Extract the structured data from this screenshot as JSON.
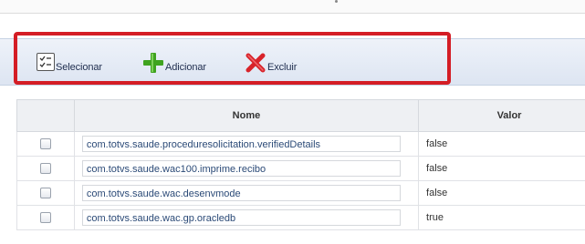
{
  "toolbar": {
    "select_label": "Selecionar",
    "add_label": "Adicionar",
    "delete_label": "Excluir"
  },
  "table": {
    "headers": {
      "nome": "Nome",
      "valor": "Valor"
    },
    "rows": [
      {
        "nome": "com.totvs.saude.proceduresolicitation.verifiedDetails",
        "valor": "false"
      },
      {
        "nome": "com.totvs.saude.wac100.imprime.recibo",
        "valor": "false"
      },
      {
        "nome": "com.totvs.saude.wac.desenvmode",
        "valor": "false"
      },
      {
        "nome": "com.totvs.saude.wac.gp.oracledb",
        "valor": "true"
      }
    ]
  },
  "colors": {
    "highlight": "#d41d25",
    "add_icon": "#3fa31f",
    "delete_icon": "#d8232a",
    "toolbar_bg": "#dde5f2"
  },
  "icons": {
    "select": "checklist-icon",
    "add": "plus-icon",
    "delete": "x-icon"
  }
}
